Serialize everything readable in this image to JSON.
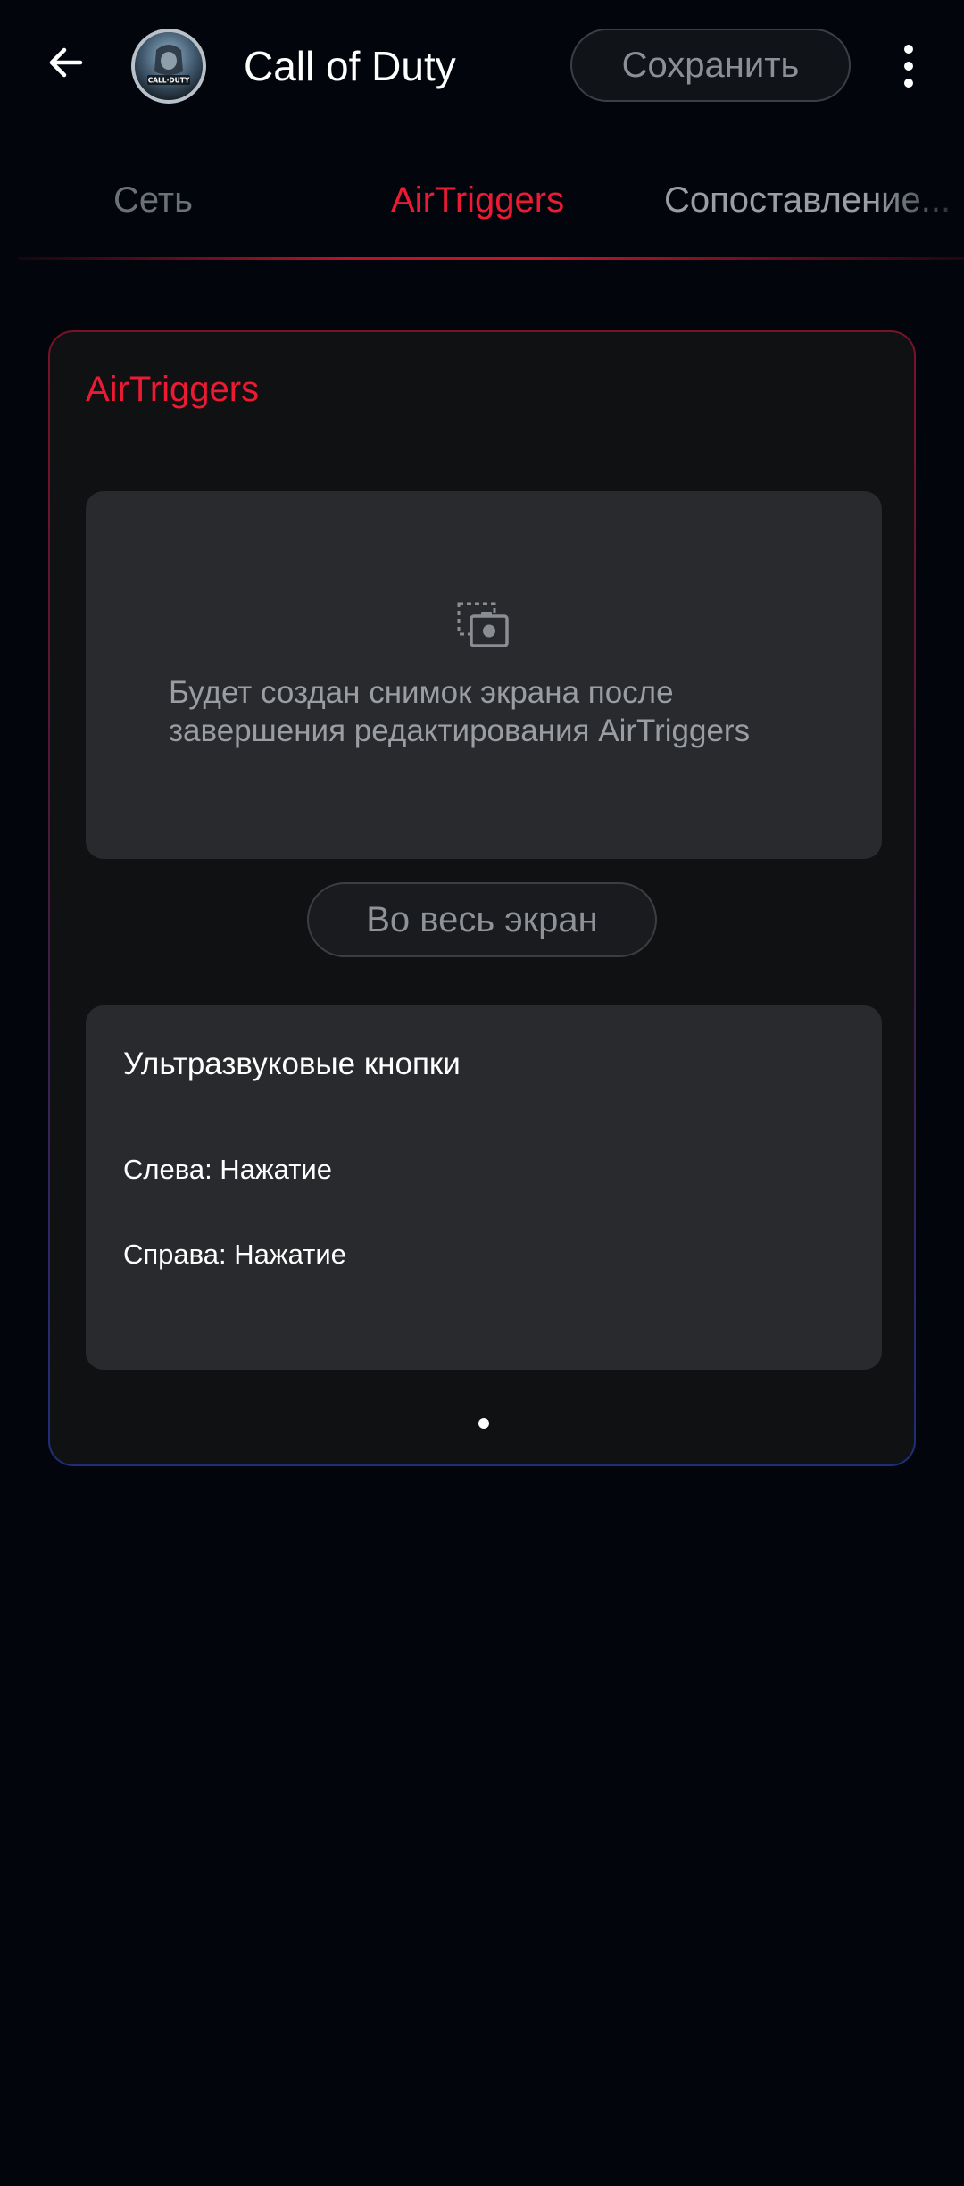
{
  "header": {
    "title": "Call of Duty",
    "save_label": "Сохранить",
    "avatar_text": "CALL·DUTY"
  },
  "tabs": [
    {
      "label": "Сеть",
      "active": false
    },
    {
      "label": "AirTriggers",
      "active": true
    },
    {
      "label": "Сопоставление...",
      "active": false
    }
  ],
  "card": {
    "title": "AirTriggers",
    "preview_text": "Будет создан снимок экрана после завершения редактирования AirTriggers",
    "fullscreen_label": "Во весь экран",
    "ultrasonic": {
      "title": "Ультразвуковые кнопки",
      "left": "Слева: Нажатие",
      "right": "Справа: Нажатие"
    }
  },
  "colors": {
    "accent": "#ec1b33",
    "background": "#03050d",
    "panel": "#282a2e"
  },
  "icons": {
    "back": "arrow-left-icon",
    "more": "more-vert-icon",
    "preview": "screenshot-icon"
  }
}
